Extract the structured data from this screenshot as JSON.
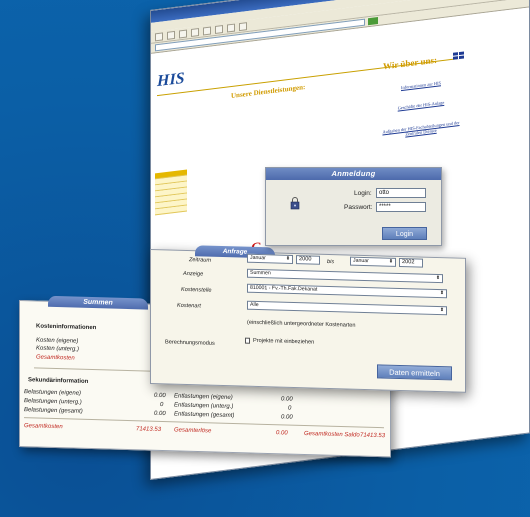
{
  "browser": {
    "title": "",
    "menus": [
      "",
      "",
      "",
      "",
      "",
      ""
    ],
    "address": ""
  },
  "site": {
    "logo": "HIS",
    "left_nav": [
      "",
      "",
      "",
      "",
      "",
      "",
      ""
    ],
    "section_left": "Unsere Dienstleistungen:",
    "section_right": "Wir über uns:",
    "links_left": [
      "",
      "",
      "",
      ""
    ],
    "links_right": [
      "Informationen zur HIS",
      "Geschäfte der HIS-Anlage",
      "Aufgaben der HIS-Fachabteilungen und der Zentralen Dienste"
    ]
  },
  "anmeldung": {
    "title": "Anmeldung",
    "login_label": "Login:",
    "login_value": "otto",
    "password_label": "Passwort:",
    "password_value": "*****",
    "button": "Login"
  },
  "anfrage": {
    "title": "Anfrage",
    "zeitraum_label": "Zeitraum",
    "from_month": "Januar",
    "from_year": "2000",
    "bis_label": "bis",
    "to_month": "Januar",
    "to_year": "2002",
    "anzeige_label": "Anzeige",
    "anzeige_value": "Summen",
    "kostenstelle_label": "Kostenstelle",
    "kostenstelle_value": "810001 - Fv.-Th.Fak.Dekanat",
    "kostenart_label": "Kostenart",
    "kostenart_value": "Alle",
    "hint": "(einschließlich untergeordneter Kostenarten",
    "modus_label": "Berechnungsmodus",
    "modus_checkbox_label": "Projekte mit einbeziehen",
    "button": "Daten ermitteln"
  },
  "summen": {
    "title": "Summen",
    "kosten_header": "Kosteninformationen",
    "kosten_eigene_label": "Kosten (eigene)",
    "kosten_unterg_label": "Kosten (unterg.)",
    "gesamtkosten_label": "Gesamtkosten",
    "sek_header": "Sekundärinformation",
    "rows": [
      {
        "label": "Belastungen (eigene)",
        "value": "0.00",
        "label2": "Entlastungen (eigene)",
        "value2": "0.00"
      },
      {
        "label": "Belastungen (unterg.)",
        "value": "0",
        "label2": "Entlastungen (unterg.)",
        "value2": "0"
      },
      {
        "label": "Belastungen (gesamt)",
        "value": "0.00",
        "label2": "Entlastungen (gesamt)",
        "value2": "0.00"
      }
    ],
    "footer_gesamtkosten_label": "Gesamtkosten",
    "footer_gesamtkosten_value": "71413.53",
    "footer_gesamterloese_label": "Gesamterlöse",
    "footer_gesamterloese_value": "0.00",
    "footer_saldo_label": "Gesamtkosten Saldo",
    "footer_saldo_value": "71413.53"
  },
  "colors": {
    "background": "#0b5fa6",
    "accent_blue": "#4f6cae",
    "his_gold": "#d19b00",
    "saldo_red": "#c0271f"
  }
}
